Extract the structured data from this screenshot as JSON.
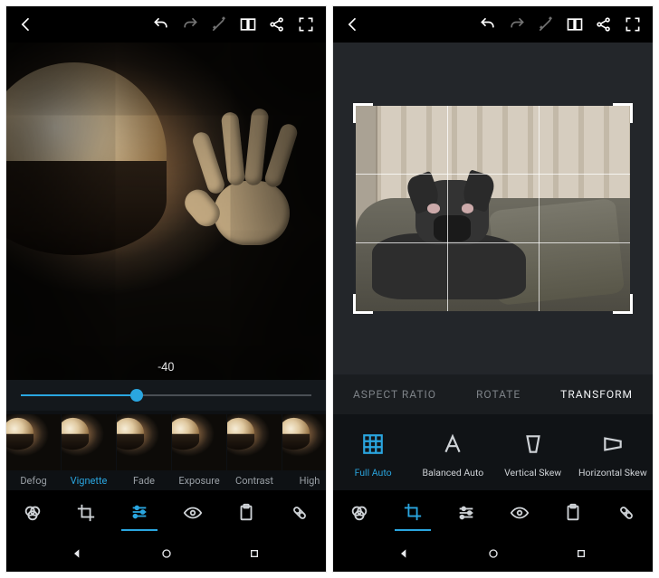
{
  "left": {
    "adjust_value": "-40",
    "slider_percent": 40,
    "presets": [
      {
        "label": "Defog"
      },
      {
        "label": "Vignette",
        "active": true
      },
      {
        "label": "Fade"
      },
      {
        "label": "Exposure"
      },
      {
        "label": "Contrast"
      },
      {
        "label": "High"
      }
    ],
    "tools": [
      {
        "name": "looks"
      },
      {
        "name": "crop"
      },
      {
        "name": "adjust",
        "active": true
      },
      {
        "name": "eye"
      },
      {
        "name": "clipboard"
      },
      {
        "name": "heal"
      }
    ]
  },
  "right": {
    "tabs": [
      {
        "label": "ASPECT RATIO"
      },
      {
        "label": "ROTATE"
      },
      {
        "label": "TRANSFORM",
        "active": true
      }
    ],
    "options": [
      {
        "label": "Full Auto",
        "active": true,
        "icon": "grid"
      },
      {
        "label": "Balanced Auto",
        "icon": "letter-a"
      },
      {
        "label": "Vertical Skew",
        "icon": "vskew"
      },
      {
        "label": "Horizontal Skew",
        "icon": "hskew"
      }
    ],
    "tools": [
      {
        "name": "looks"
      },
      {
        "name": "crop",
        "active": true
      },
      {
        "name": "adjust"
      },
      {
        "name": "eye"
      },
      {
        "name": "clipboard"
      },
      {
        "name": "heal"
      }
    ]
  },
  "icons": {
    "back": "back-icon",
    "undo": "undo-icon",
    "redo": "redo-icon",
    "wand": "magic-wand-icon",
    "compare": "compare-icon",
    "share": "share-icon",
    "fullscreen": "fullscreen-icon"
  }
}
